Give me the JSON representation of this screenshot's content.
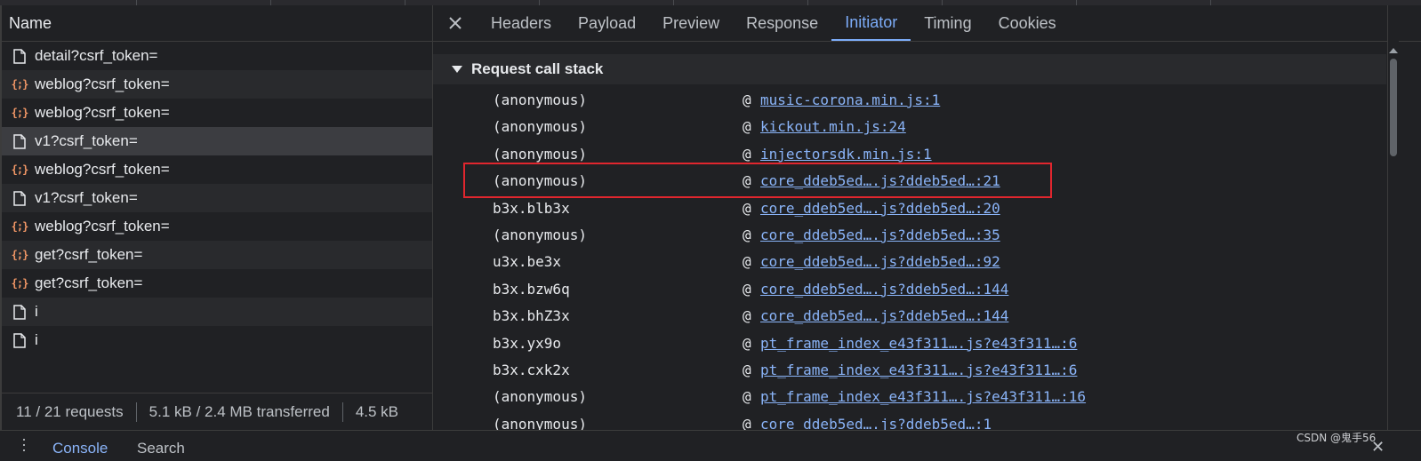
{
  "requests_panel": {
    "column_header": "Name",
    "requests": [
      {
        "name": "detail?csrf_token=",
        "icon": "document-icon"
      },
      {
        "name": "weblog?csrf_token=",
        "icon": "fetch-icon"
      },
      {
        "name": "weblog?csrf_token=",
        "icon": "fetch-icon"
      },
      {
        "name": "v1?csrf_token=",
        "icon": "document-icon"
      },
      {
        "name": "weblog?csrf_token=",
        "icon": "fetch-icon"
      },
      {
        "name": "v1?csrf_token=",
        "icon": "document-icon"
      },
      {
        "name": "weblog?csrf_token=",
        "icon": "fetch-icon"
      },
      {
        "name": "get?csrf_token=",
        "icon": "fetch-icon"
      },
      {
        "name": "get?csrf_token=",
        "icon": "fetch-icon"
      },
      {
        "name": "i",
        "icon": "document-icon"
      },
      {
        "name": "i",
        "icon": "document-icon"
      }
    ],
    "status": {
      "requests": "11 / 21 requests",
      "transferred": "5.1 kB / 2.4 MB transferred",
      "resources": "4.5 kB"
    }
  },
  "detail_panel": {
    "close_icon": "close-icon",
    "tabs": [
      {
        "label": "Headers",
        "active": false
      },
      {
        "label": "Payload",
        "active": false
      },
      {
        "label": "Preview",
        "active": false
      },
      {
        "label": "Response",
        "active": false
      },
      {
        "label": "Initiator",
        "active": true
      },
      {
        "label": "Timing",
        "active": false
      },
      {
        "label": "Cookies",
        "active": false
      }
    ],
    "section_title": "Request call stack",
    "call_stack": [
      {
        "fn": "(anonymous)",
        "at": "@",
        "src": "music-corona.min.js:1"
      },
      {
        "fn": "(anonymous)",
        "at": "@",
        "src": "kickout.min.js:24"
      },
      {
        "fn": "(anonymous)",
        "at": "@",
        "src": "injectorsdk.min.js:1"
      },
      {
        "fn": "(anonymous)",
        "at": "@",
        "src": "core_ddeb5ed….js?ddeb5ed…:21"
      },
      {
        "fn": "b3x.blb3x",
        "at": "@",
        "src": "core_ddeb5ed….js?ddeb5ed…:20"
      },
      {
        "fn": "(anonymous)",
        "at": "@",
        "src": "core_ddeb5ed….js?ddeb5ed…:35"
      },
      {
        "fn": "u3x.be3x",
        "at": "@",
        "src": "core_ddeb5ed….js?ddeb5ed…:92"
      },
      {
        "fn": "b3x.bzw6q",
        "at": "@",
        "src": "core_ddeb5ed….js?ddeb5ed…:144"
      },
      {
        "fn": "b3x.bhZ3x",
        "at": "@",
        "src": "core_ddeb5ed….js?ddeb5ed…:144"
      },
      {
        "fn": "b3x.yx9o",
        "at": "@",
        "src": "pt_frame_index_e43f311….js?e43f311…:6"
      },
      {
        "fn": "b3x.cxk2x",
        "at": "@",
        "src": "pt_frame_index_e43f311….js?e43f311…:6"
      },
      {
        "fn": "(anonymous)",
        "at": "@",
        "src": "pt_frame_index_e43f311….js?e43f311…:16"
      },
      {
        "fn": "(anonymous)",
        "at": "@",
        "src": "core_ddeb5ed….js?ddeb5ed…:1"
      }
    ]
  },
  "drawer": {
    "menu_icon": "kebab-menu-icon",
    "tabs": [
      {
        "label": "Console",
        "active": true
      },
      {
        "label": "Search",
        "active": false
      }
    ],
    "close_icon": "close-icon"
  },
  "watermark": "CSDN @鬼手56",
  "colors": {
    "background": "#202124",
    "link": "#8ab4f8",
    "active_tab": "#7cacf8",
    "fetch_icon": "#f29766",
    "highlight_box": "#e0262e"
  }
}
